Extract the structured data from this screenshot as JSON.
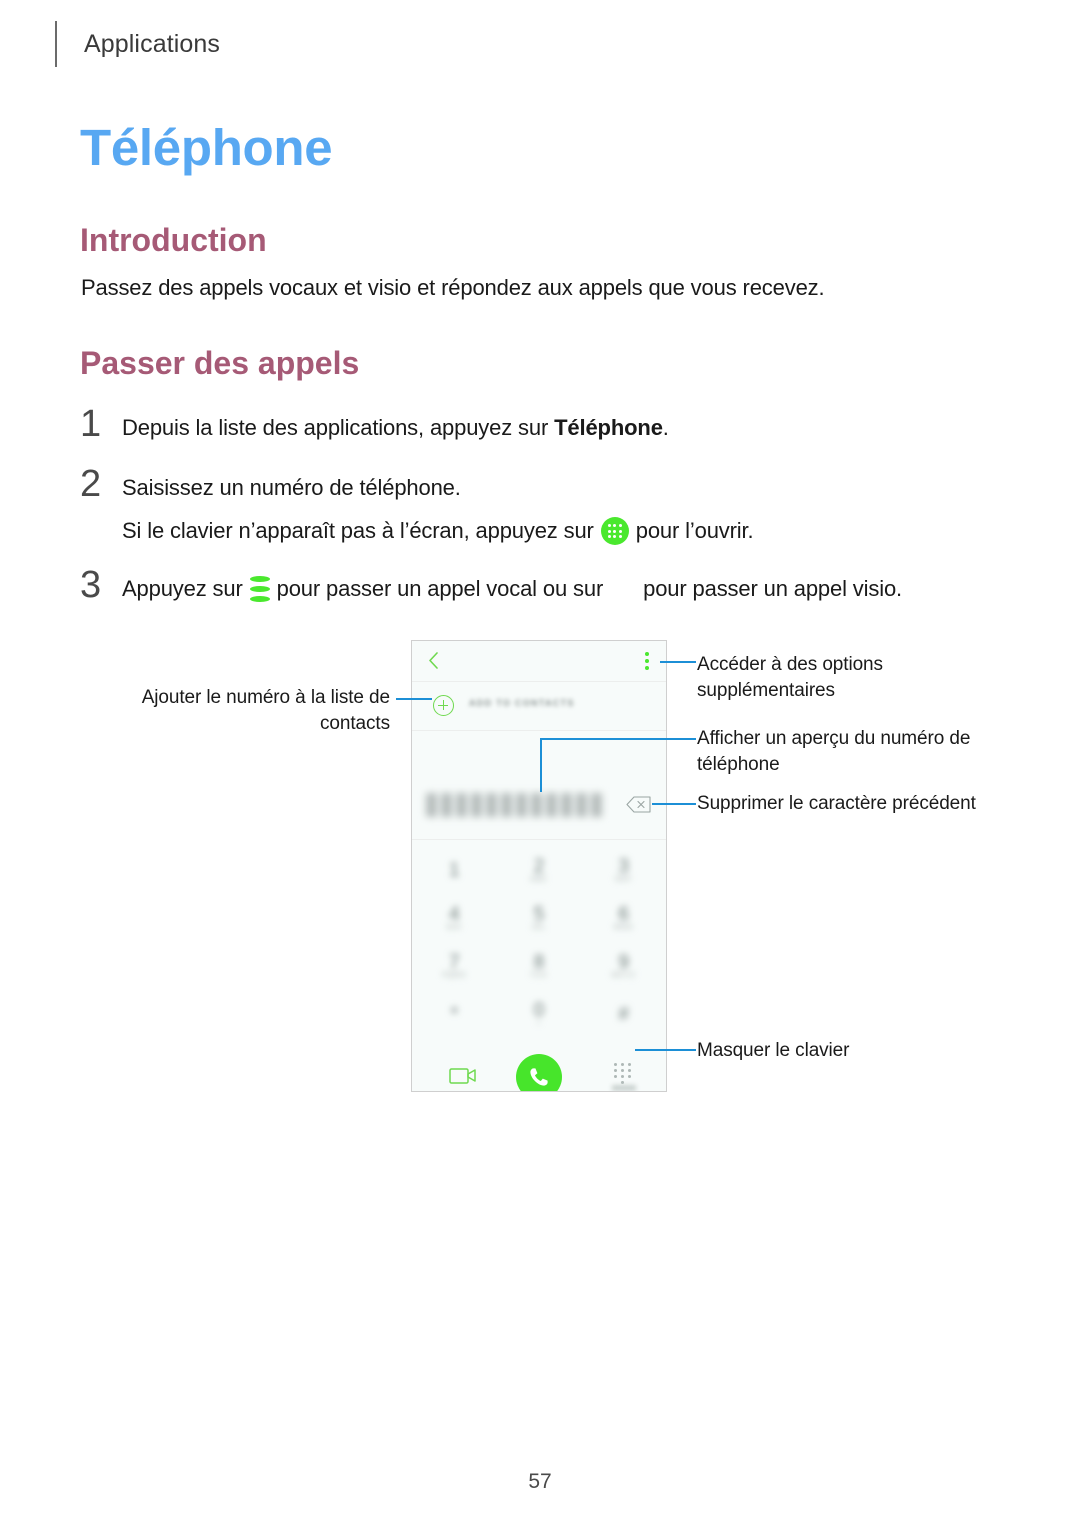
{
  "header": {
    "section_label": "Applications"
  },
  "page_title": "Téléphone",
  "headings": {
    "introduction": "Introduction",
    "passer_des_appels": "Passer des appels"
  },
  "intro_paragraph": "Passez des appels vocaux et visio et répondez aux appels que vous recevez.",
  "steps": [
    {
      "number": "1",
      "text_before": "Depuis la liste des applications, appuyez sur ",
      "bold": "Téléphone",
      "text_after": "."
    },
    {
      "number": "2",
      "text": "Saisissez un numéro de téléphone.",
      "sub_before": "Si le clavier n’apparaît pas à l’écran, appuyez sur",
      "sub_icon": "keypad-green-icon",
      "sub_after": "pour l’ouvrir."
    },
    {
      "number": "3",
      "text_before": "Appuyez sur",
      "icon_call": "call-green-icon",
      "text_middle": "pour passer un appel vocal ou sur",
      "icon_video": "video-call-icon",
      "text_after": "pour passer un appel visio."
    }
  ],
  "phone_mock": {
    "back_icon": "chevron-left-icon",
    "more_icon": "more-vertical-icon",
    "plus_icon": "plus-circle-icon",
    "add_to_contacts_label": "ADD TO CONTACTS",
    "number_display": "",
    "backspace_icon": "backspace-icon",
    "keypad": [
      [
        {
          "digit": "1",
          "sub": ""
        },
        {
          "digit": "2",
          "sub": "ABC"
        },
        {
          "digit": "3",
          "sub": "DEF"
        }
      ],
      [
        {
          "digit": "4",
          "sub": "GHI"
        },
        {
          "digit": "5",
          "sub": "JKL"
        },
        {
          "digit": "6",
          "sub": "MNO"
        }
      ],
      [
        {
          "digit": "7",
          "sub": "PQRS"
        },
        {
          "digit": "8",
          "sub": "TUV"
        },
        {
          "digit": "9",
          "sub": "WXYZ"
        }
      ],
      [
        {
          "digit": "*",
          "sub": ""
        },
        {
          "digit": "0",
          "sub": "+"
        },
        {
          "digit": "#",
          "sub": ""
        }
      ]
    ],
    "video_icon": "video-camera-icon",
    "call_button_icon": "phone-handset-icon",
    "keypad_toggle_icon": "keypad-dots-icon"
  },
  "callouts": {
    "options": "Accéder à des options supplémentaires",
    "preview": "Afficher un aperçu du numéro de téléphone",
    "backspace": "Supprimer le caractère précédent",
    "hide_keyboard": "Masquer le clavier",
    "add_contact": "Ajouter le numéro à la liste de contacts"
  },
  "page_number": "57",
  "colors": {
    "title_blue": "#58a8f2",
    "heading_mauve": "#a65a76",
    "accent_green": "#4ae82e",
    "lead_blue": "#1c8fd6"
  }
}
